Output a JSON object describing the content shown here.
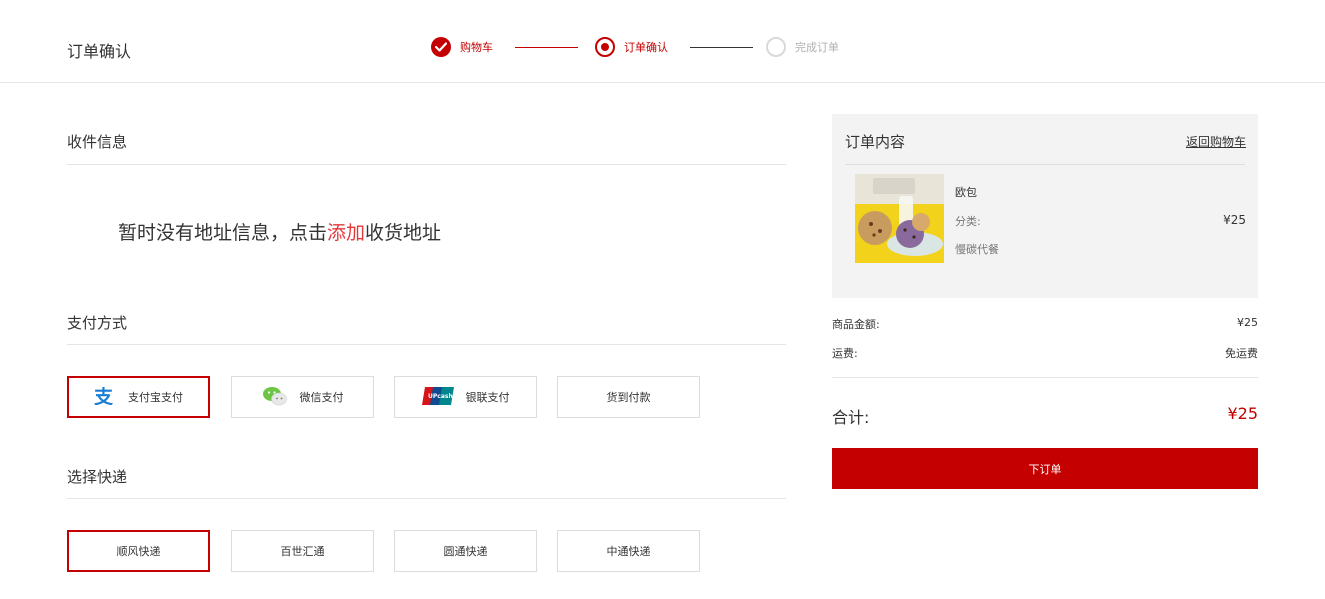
{
  "header": {
    "title": "订单确认",
    "steps": [
      {
        "label": "购物车",
        "state": "done"
      },
      {
        "label": "订单确认",
        "state": "active"
      },
      {
        "label": "完成订单",
        "state": "pending"
      }
    ]
  },
  "address": {
    "title": "收件信息",
    "empty_prefix": "暂时没有地址信息，点击",
    "add_link": "添加",
    "empty_suffix": "收货地址"
  },
  "payment": {
    "title": "支付方式",
    "options": [
      {
        "label": "支付宝支付",
        "icon": "alipay-icon",
        "selected": true
      },
      {
        "label": "微信支付",
        "icon": "wechat-icon",
        "selected": false
      },
      {
        "label": "银联支付",
        "icon": "unionpay-icon",
        "selected": false
      },
      {
        "label": "货到付款",
        "icon": "",
        "selected": false
      }
    ]
  },
  "shipping": {
    "title": "选择快递",
    "options": [
      {
        "label": "顺风快递",
        "selected": true
      },
      {
        "label": "百世汇通",
        "selected": false
      },
      {
        "label": "圆通快递",
        "selected": false
      },
      {
        "label": "中通快递",
        "selected": false
      }
    ]
  },
  "order": {
    "title": "订单内容",
    "back_link": "返回购物车",
    "item": {
      "name": "欧包",
      "category_label": "分类:",
      "spec": "慢碳代餐",
      "price": "¥25"
    },
    "goods_amount_label": "商品金额:",
    "goods_amount": "¥25",
    "shipping_label": "运费:",
    "shipping_value": "免运费",
    "total_label": "合计:",
    "total_value": "¥25",
    "submit_label": "下订单"
  },
  "colors": {
    "accent": "#c40000",
    "link_red": "#e4393c",
    "panel_bg": "#f3f3f3"
  }
}
